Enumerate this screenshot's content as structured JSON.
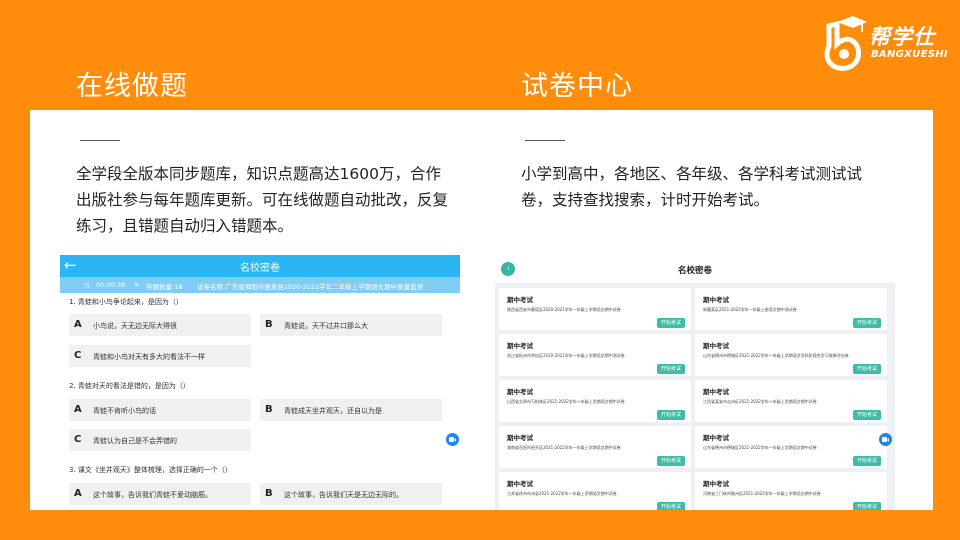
{
  "logo": {
    "cn": "帮学仕",
    "en": "BANGXUESHI"
  },
  "left": {
    "title": "在线做题",
    "desc": "全学段全版本同步题库，知识点题高达1600万，合作出版社参与每年题库更新。可在线做题自动批改，反复练习，且错题自动归入错题本。"
  },
  "right": {
    "title": "试卷中心",
    "desc": "小学到高中，各地区、各年级、各学科考试测试试卷，支持查找搜索，计时开始考试。"
  },
  "quiz": {
    "header_title": "名校密卷",
    "back_icon": "back-arrow-icon",
    "timer": "00:00:38",
    "count": "答题数量:18",
    "paper": "试卷名称:广东省揭阳市惠来县2020-2021学年二年级上学期语文期中质量监测",
    "questions": [
      {
        "title": "1. 青蛙和小鸟争论起来，是因为（）",
        "options": [
          {
            "letter": "A",
            "text": "小鸟说，天无边无际大得很"
          },
          {
            "letter": "B",
            "text": "青蛙说，天不过井口那么大"
          },
          {
            "letter": "C",
            "text": "青蛙和小鸟对天有多大的看法不一样"
          }
        ]
      },
      {
        "title": "2. 青蛙对天的看法是错的，是因为（）",
        "options": [
          {
            "letter": "A",
            "text": "青蛙不肯听小鸟的话"
          },
          {
            "letter": "B",
            "text": "青蛙成天坐井观天，还自以为是"
          },
          {
            "letter": "C",
            "text": "青蛙认为自己是不会弄错的"
          }
        ]
      },
      {
        "title": "3. 课文《坐井观天》整体梳理，选择正确的一个（）",
        "options": [
          {
            "letter": "A",
            "text": "这个故事，告诉我们青蛙不爱动脑筋。"
          },
          {
            "letter": "B",
            "text": "这个故事，告诉我们天是无边无际的。"
          }
        ]
      }
    ]
  },
  "papers": {
    "header_title": "名校密卷",
    "back_glyph": "‹",
    "button_label": "开始考试",
    "cards": [
      {
        "title": "期中考试",
        "sub": "陕西省西安市雁塔区2020-2021学年一年级上学期语文期中试卷"
      },
      {
        "title": "期中考试",
        "sub": "新疆某区2021-2022学年一年级上册语文期中测试卷"
      },
      {
        "title": "期中考试",
        "sub": "浙江省杭州市余杭区2020-2021学年一年级上学期语文期中测试卷"
      },
      {
        "title": "期中考试",
        "sub": "山东省德州市德城区2021-2022学年一年级上学期语文学科阶段性学习效果评估卷"
      },
      {
        "title": "期中考试",
        "sub": "山西省太原市万柏林区2021-2022学年一年级上学期语文期中试卷"
      },
      {
        "title": "期中考试",
        "sub": "江西省某安市吉州区2021-2022学年一年级上学期语文期中试卷"
      },
      {
        "title": "期中考试",
        "sub": "湖南省岳阳市经开区2021-2022学年一年级上学期语文期中试卷"
      },
      {
        "title": "期中考试",
        "sub": "山东省德州市德城区2021-2022学年一年级上学期语文期中试卷"
      },
      {
        "title": "期中考试",
        "sub": "江苏省徐州市沛县2021-2022学年一年级上学期语文期中试卷"
      },
      {
        "title": "期中考试",
        "sub": "河南省三门峡市陕州区2021-2022学年一年级上学期语文期中试卷"
      }
    ]
  },
  "colors": {
    "background": "#FF8C0A",
    "header_blue": "#2CB5F5",
    "button_teal": "#3DBDA7"
  }
}
